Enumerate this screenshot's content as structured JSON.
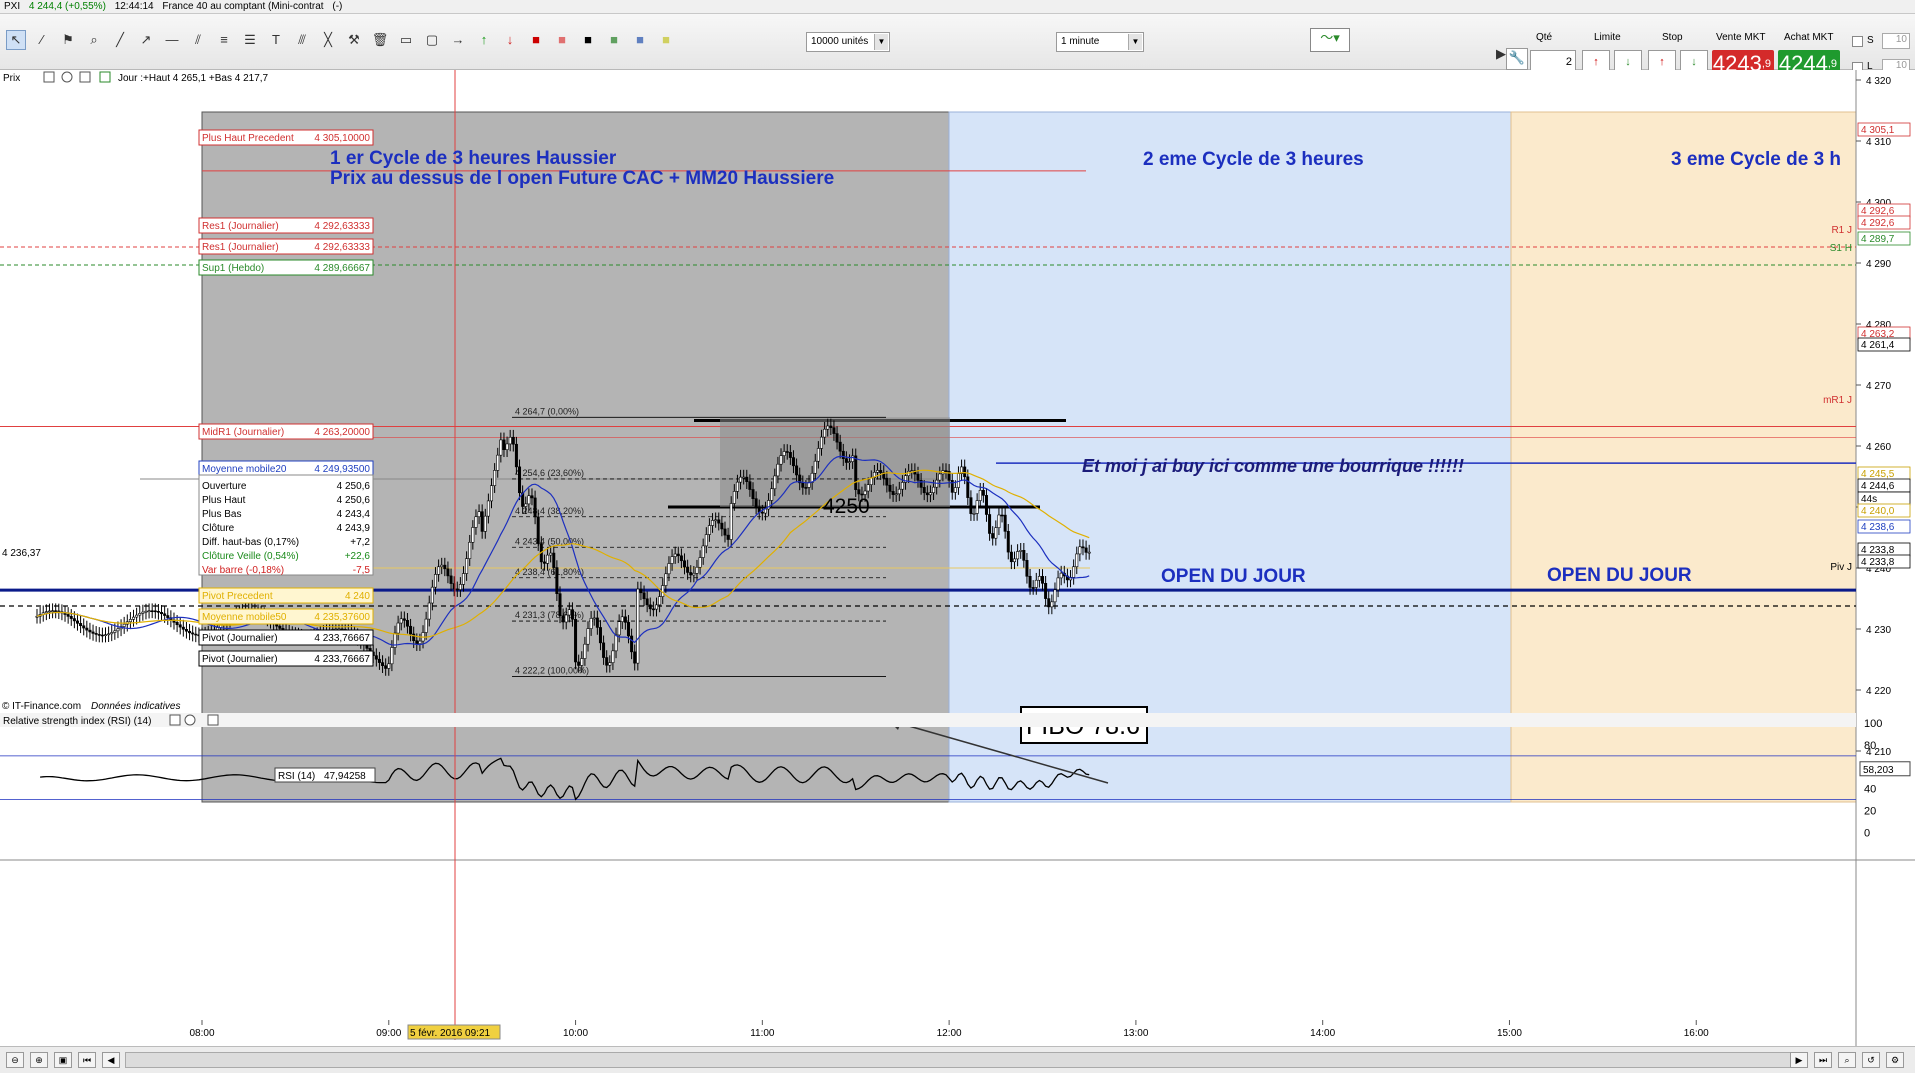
{
  "titlebar": {
    "symbol": "PXI",
    "price": "4 244,4 (+0,55%)",
    "time": "12:44:14",
    "instrument": "France 40 au comptant (Mini-contrat",
    "suffix": "(-)"
  },
  "toolbar": {
    "units_select": "10000 unités",
    "interval_select": "1 minute"
  },
  "order_panel": {
    "qty_label": "Qté",
    "qty_value": "2",
    "limit_label": "Limite",
    "stop_label": "Stop",
    "sell_label": "Vente MKT",
    "buy_label": "Achat MKT",
    "sell_price_main": "4243",
    "sell_price_dec": ",9",
    "buy_price_main": "4244",
    "buy_price_dec": ",9",
    "s_label": "S",
    "l_label": "L",
    "s_value": "10",
    "l_value": "10",
    "sell_color": "#d42a2a",
    "buy_color": "#1f9a2e"
  },
  "chart": {
    "panel_label": "Prix",
    "header_info": "Jour :+Haut 4 265,1 +Bas 4 217,7",
    "copyright": "© IT-Finance.com",
    "copyright_note": "Données indicatives",
    "y_ticks": [
      "4 320",
      "4 310",
      "4 300",
      "4 290",
      "4 280",
      "4 270",
      "4 260",
      "4 250",
      "4 240",
      "4 230",
      "4 220",
      "4 210"
    ],
    "price_tags": [
      {
        "text": "4 305,1",
        "color": "#d03030"
      },
      {
        "text": "4 292,6",
        "color": "#d03030"
      },
      {
        "text": "4 292,6",
        "color": "#d03030"
      },
      {
        "text": "4 289,7",
        "color": "#2a8a2a"
      },
      {
        "text": "4 263,2",
        "color": "#d03030"
      },
      {
        "text": "4 261,4",
        "color": "#000000"
      },
      {
        "text": "4 245,5",
        "color": "#c8a000"
      },
      {
        "text": "4 244,6",
        "color": "#000000"
      },
      {
        "text": "44s",
        "color": "#000000"
      },
      {
        "text": "4 240,0",
        "color": "#c8a000"
      },
      {
        "text": "4 238,6",
        "color": "#2040c0"
      },
      {
        "text": "4 233,8",
        "color": "#000000"
      },
      {
        "text": "4 233,8",
        "color": "#000000"
      }
    ],
    "right_marks": {
      "r1": "R1 J",
      "s1": "S1 H",
      "mr1": "mR1 J",
      "piv": "Piv J"
    },
    "x_ticks": [
      "08:00",
      "09:00",
      "10:00",
      "11:00",
      "12:00",
      "13:00",
      "14:00",
      "15:00",
      "16:00"
    ],
    "cursor_date": "5 févr. 2016 09:21",
    "left_price": "4 236,37",
    "cycle1_line1": "1 er Cycle de 3 heures Haussier",
    "cycle1_line2": "Prix au dessus de l open Future CAC + MM20 Haussiere",
    "cycle2": "2 eme  Cycle de 3 heures",
    "cycle3": "3 eme  Cycle de 3 h",
    "comment": "Et moi j ai buy ici comme une bourrique !!!!!!",
    "open_label_1": "OPEN DU JOUR",
    "open_label_2": "OPEN DU JOUR",
    "level_4250": "4250",
    "fibo_label": "FIBO 78.6",
    "fib_levels": [
      "4 264,7 (0,00%)",
      "4 254,6 (23,60%)",
      "4 248,4 (38,20%)",
      "4 243,4 (50,00%)",
      "4 238,4 (61,80%)",
      "4 231,3 (78,60%)",
      "4 222,2 (100,00%)"
    ],
    "level_tags": [
      {
        "name": "Plus Haut  Precedent",
        "value": "4 305,10000",
        "color": "#d03030"
      },
      {
        "name": "Res1 (Journalier)",
        "value": "4 292,63333",
        "color": "#d03030"
      },
      {
        "name": "Res1 (Journalier)",
        "value": "4 292,63333",
        "color": "#d03030"
      },
      {
        "name": "Sup1 (Hebdo)",
        "value": "4 289,66667",
        "color": "#2a8a2a"
      },
      {
        "name": "MidR1 (Journalier)",
        "value": "4 263,20000",
        "color": "#d03030"
      },
      {
        "name": "Moyenne mobile20",
        "value": "4 249,93500",
        "color": "#2040c0"
      },
      {
        "name": "Pivot  Precedent",
        "value": "4 240",
        "color": "#e0b000"
      },
      {
        "name": "Moyenne mobile50",
        "value": "4 235,37600",
        "color": "#e0b000"
      },
      {
        "name": "Pivot (Journalier)",
        "value": "4 233,76667",
        "color": "#000000"
      },
      {
        "name": "Pivot (Journalier)",
        "value": "4 233,76667",
        "color": "#000000"
      }
    ],
    "ohlc": [
      {
        "label": "Ouverture",
        "value": "4 250,6",
        "color": "#000000"
      },
      {
        "label": "Plus Haut",
        "value": "4 250,6",
        "color": "#000000"
      },
      {
        "label": "Plus Bas",
        "value": "4 243,4",
        "color": "#000000"
      },
      {
        "label": "Clôture",
        "value": "4 243,9",
        "color": "#000000"
      },
      {
        "label": "Diff. haut-bas (0,17%)",
        "value": "+7,2",
        "color": "#000000"
      },
      {
        "label": "Clôture Veille (0,54%)",
        "value": "+22,6",
        "color": "#1a8a1a"
      },
      {
        "label": "Var barre (-0,18%)",
        "value": "-7,5",
        "color": "#d02020"
      }
    ]
  },
  "rsi": {
    "label": "Relative strength index (RSI) (14)",
    "tag_name": "RSI (14)",
    "tag_value": "47,94258",
    "y_ticks": [
      "100",
      "80",
      "60",
      "40",
      "20",
      "0"
    ],
    "current": "58,203"
  }
}
